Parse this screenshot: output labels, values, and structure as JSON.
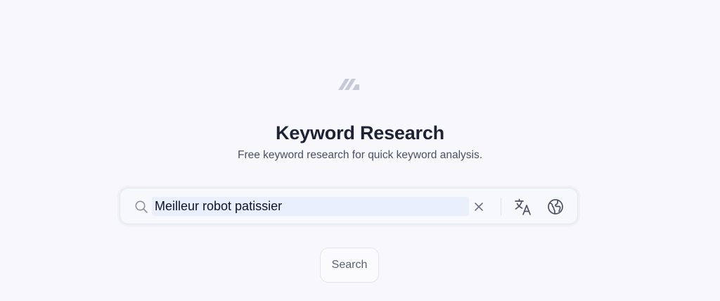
{
  "header": {
    "logo_icon": "brand-logo-icon",
    "title": "Keyword Research",
    "subtitle": "Free keyword research for quick keyword analysis."
  },
  "search_bar": {
    "icon": "search-icon",
    "value": "Meilleur robot patissier",
    "clear_icon": "close-icon",
    "translate_icon": "translate-icon",
    "globe_icon": "globe-icon"
  },
  "actions": {
    "search_label": "Search"
  },
  "colors": {
    "background": "#f8f8fc",
    "title": "#1e2235",
    "subtitle": "#475068",
    "input_highlight": "#e9effb",
    "logo": "#c6c9d9",
    "icon": "#4b5064"
  }
}
